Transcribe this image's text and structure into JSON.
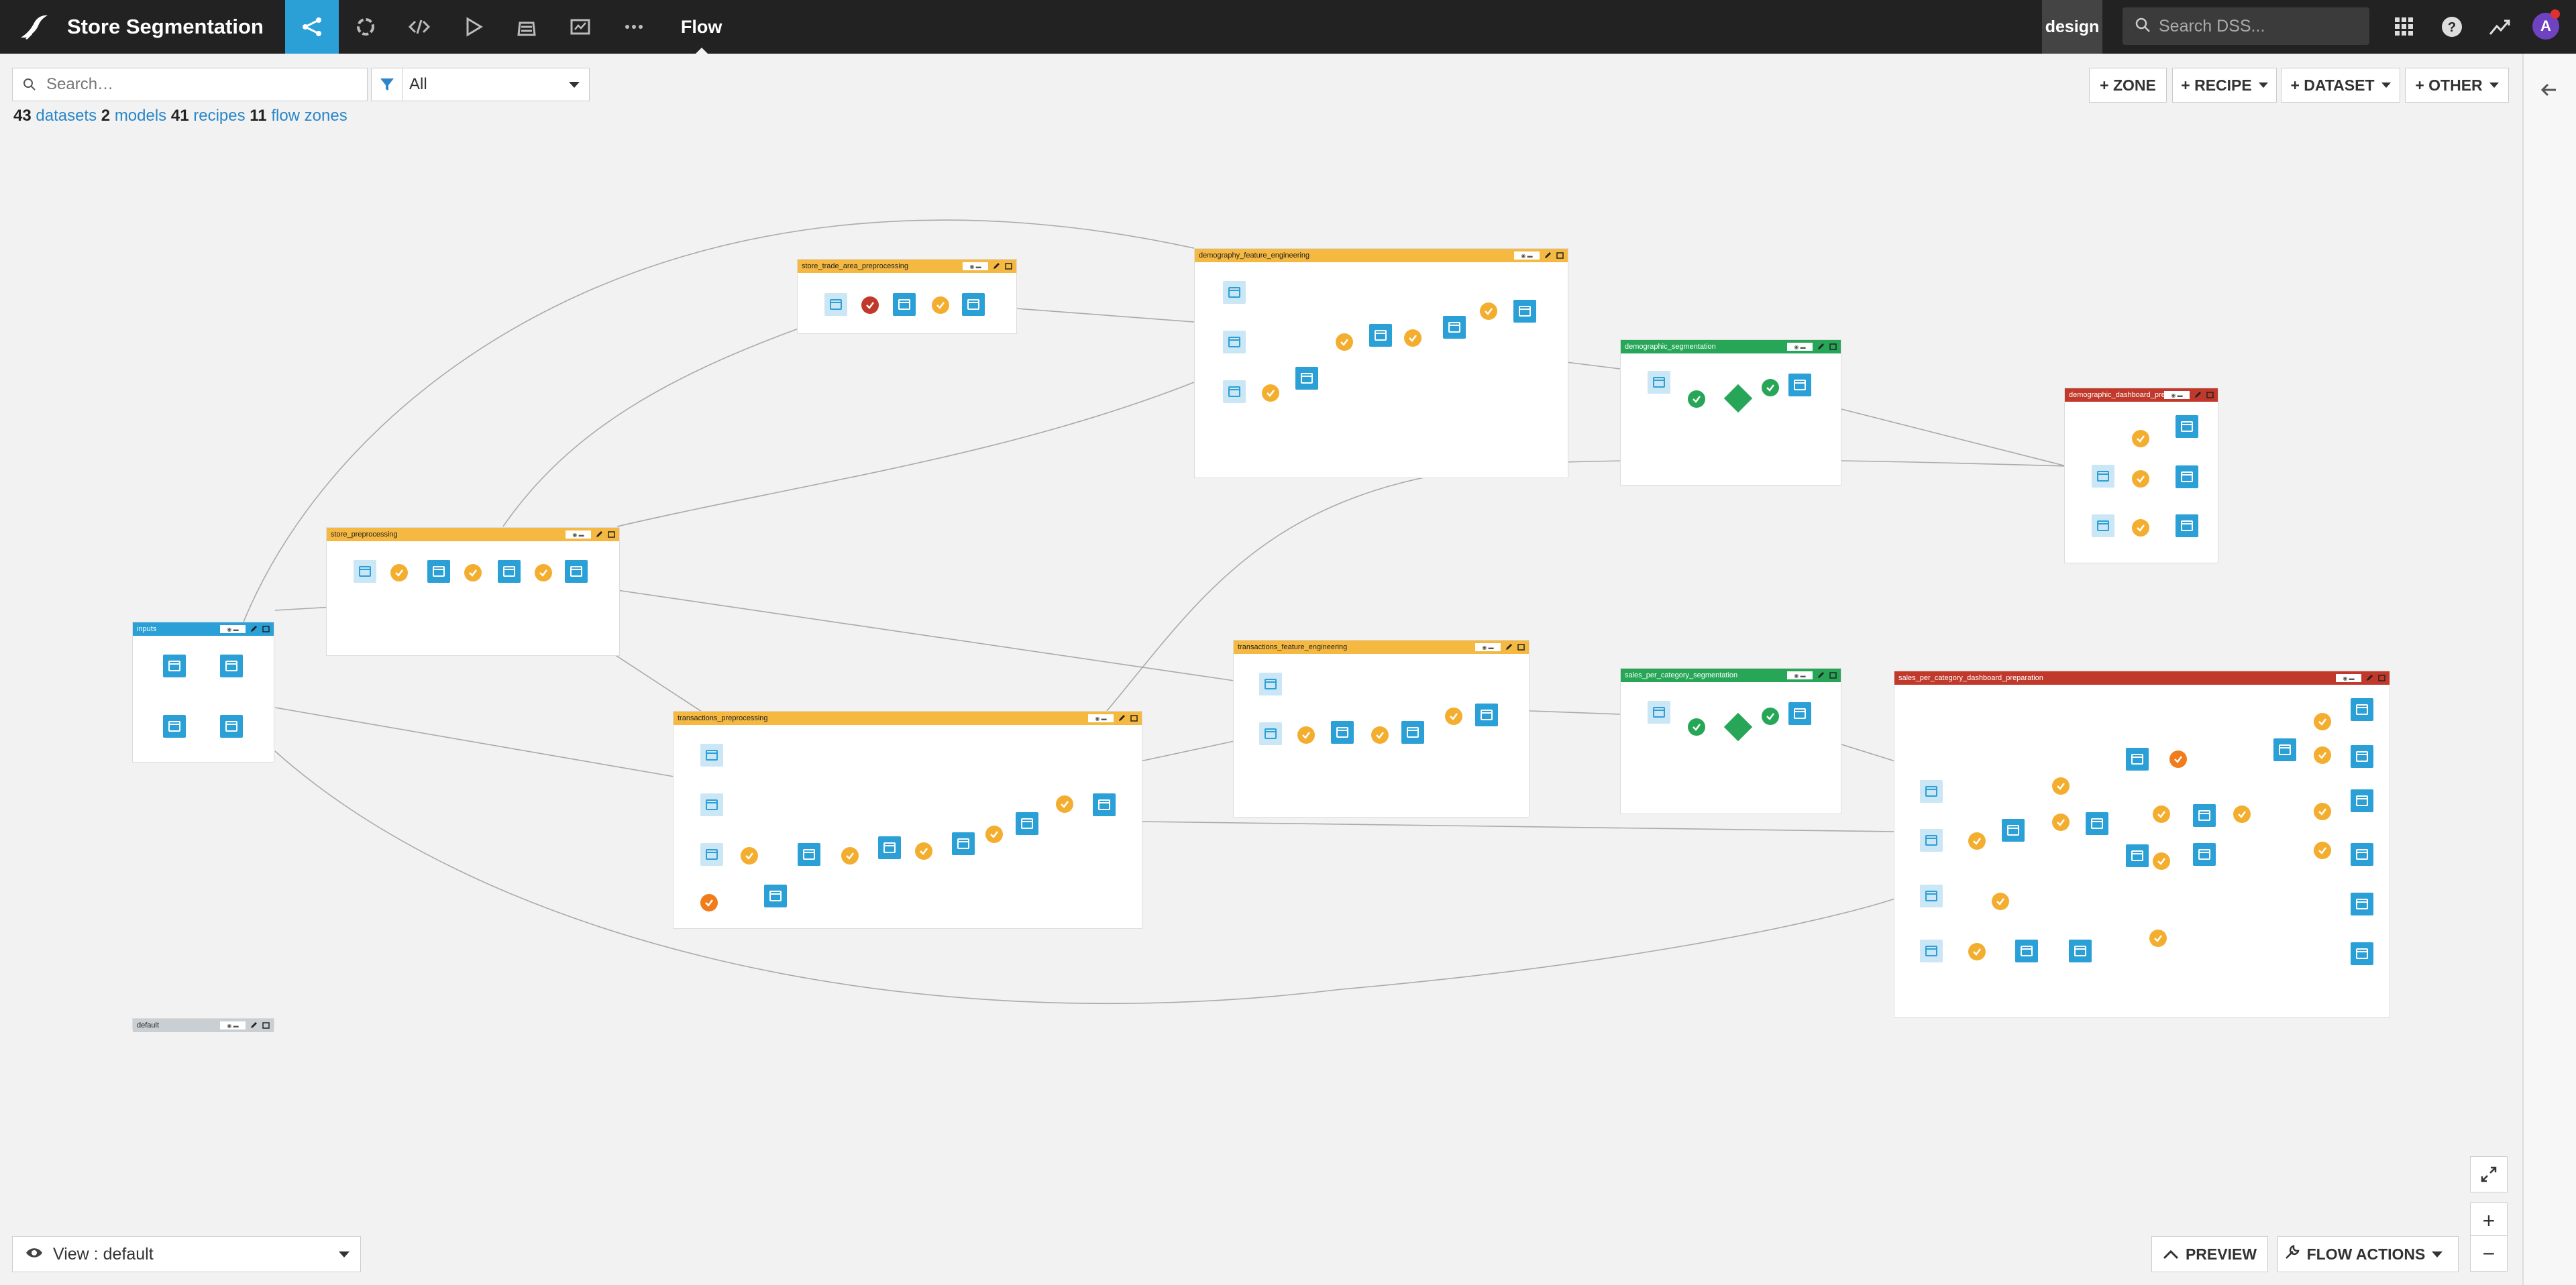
{
  "app": {
    "title": "Store Segmentation",
    "section": "Flow",
    "mode": "design"
  },
  "search": {
    "dss_placeholder": "Search DSS...",
    "flow_placeholder": "Search…"
  },
  "filter": {
    "value": "All"
  },
  "counts": {
    "datasets_count": "43",
    "datasets_label": "datasets",
    "models_count": "2",
    "models_label": "models",
    "recipes_count": "41",
    "recipes_label": "recipes",
    "zones_count": "11",
    "zones_label": "flow zones"
  },
  "actions": {
    "zone": "+ ZONE",
    "recipe": "+ RECIPE",
    "dataset": "+ DATASET",
    "other": "+ OTHER"
  },
  "user": {
    "initial": "A"
  },
  "colors": {
    "topbar": "#222222",
    "accent": "#2aa0d6",
    "yellow_zone": "#f5b942",
    "green_zone": "#27a657",
    "red_zone": "#c0392b",
    "grey_zone": "#c9cfd3",
    "blue_zone": "#2aa0d6"
  },
  "zones": [
    {
      "name": "inputs",
      "color": "blue"
    },
    {
      "name": "store_preprocessing",
      "color": "yellow"
    },
    {
      "name": "store_trade_area_preprocessing",
      "color": "yellow"
    },
    {
      "name": "demography_feature_engineering",
      "color": "yellow"
    },
    {
      "name": "demographic_segmentation",
      "color": "green"
    },
    {
      "name": "demographic_dashboard_pre...",
      "color": "red"
    },
    {
      "name": "transactions_preprocessing",
      "color": "yellow"
    },
    {
      "name": "transactions_feature_engineering",
      "color": "yellow"
    },
    {
      "name": "sales_per_category_segmentation",
      "color": "green"
    },
    {
      "name": "sales_per_category_dashboard_preparation",
      "color": "red"
    },
    {
      "name": "default",
      "color": "grey"
    }
  ],
  "bottom": {
    "view": "View : default",
    "preview": "PREVIEW",
    "flow_actions": "FLOW ACTIONS"
  },
  "icons": [
    "bird-logo-icon",
    "flow-icon",
    "lab-icon",
    "code-icon",
    "run-icon",
    "deploy-icon",
    "dashboard-icon",
    "more-icon",
    "search-icon",
    "apps-grid-icon",
    "help-icon",
    "activity-icon",
    "filter-icon",
    "eye-icon",
    "fullscreen-icon",
    "zoom-in-icon",
    "zoom-out-icon",
    "collapse-arrow-icon"
  ]
}
